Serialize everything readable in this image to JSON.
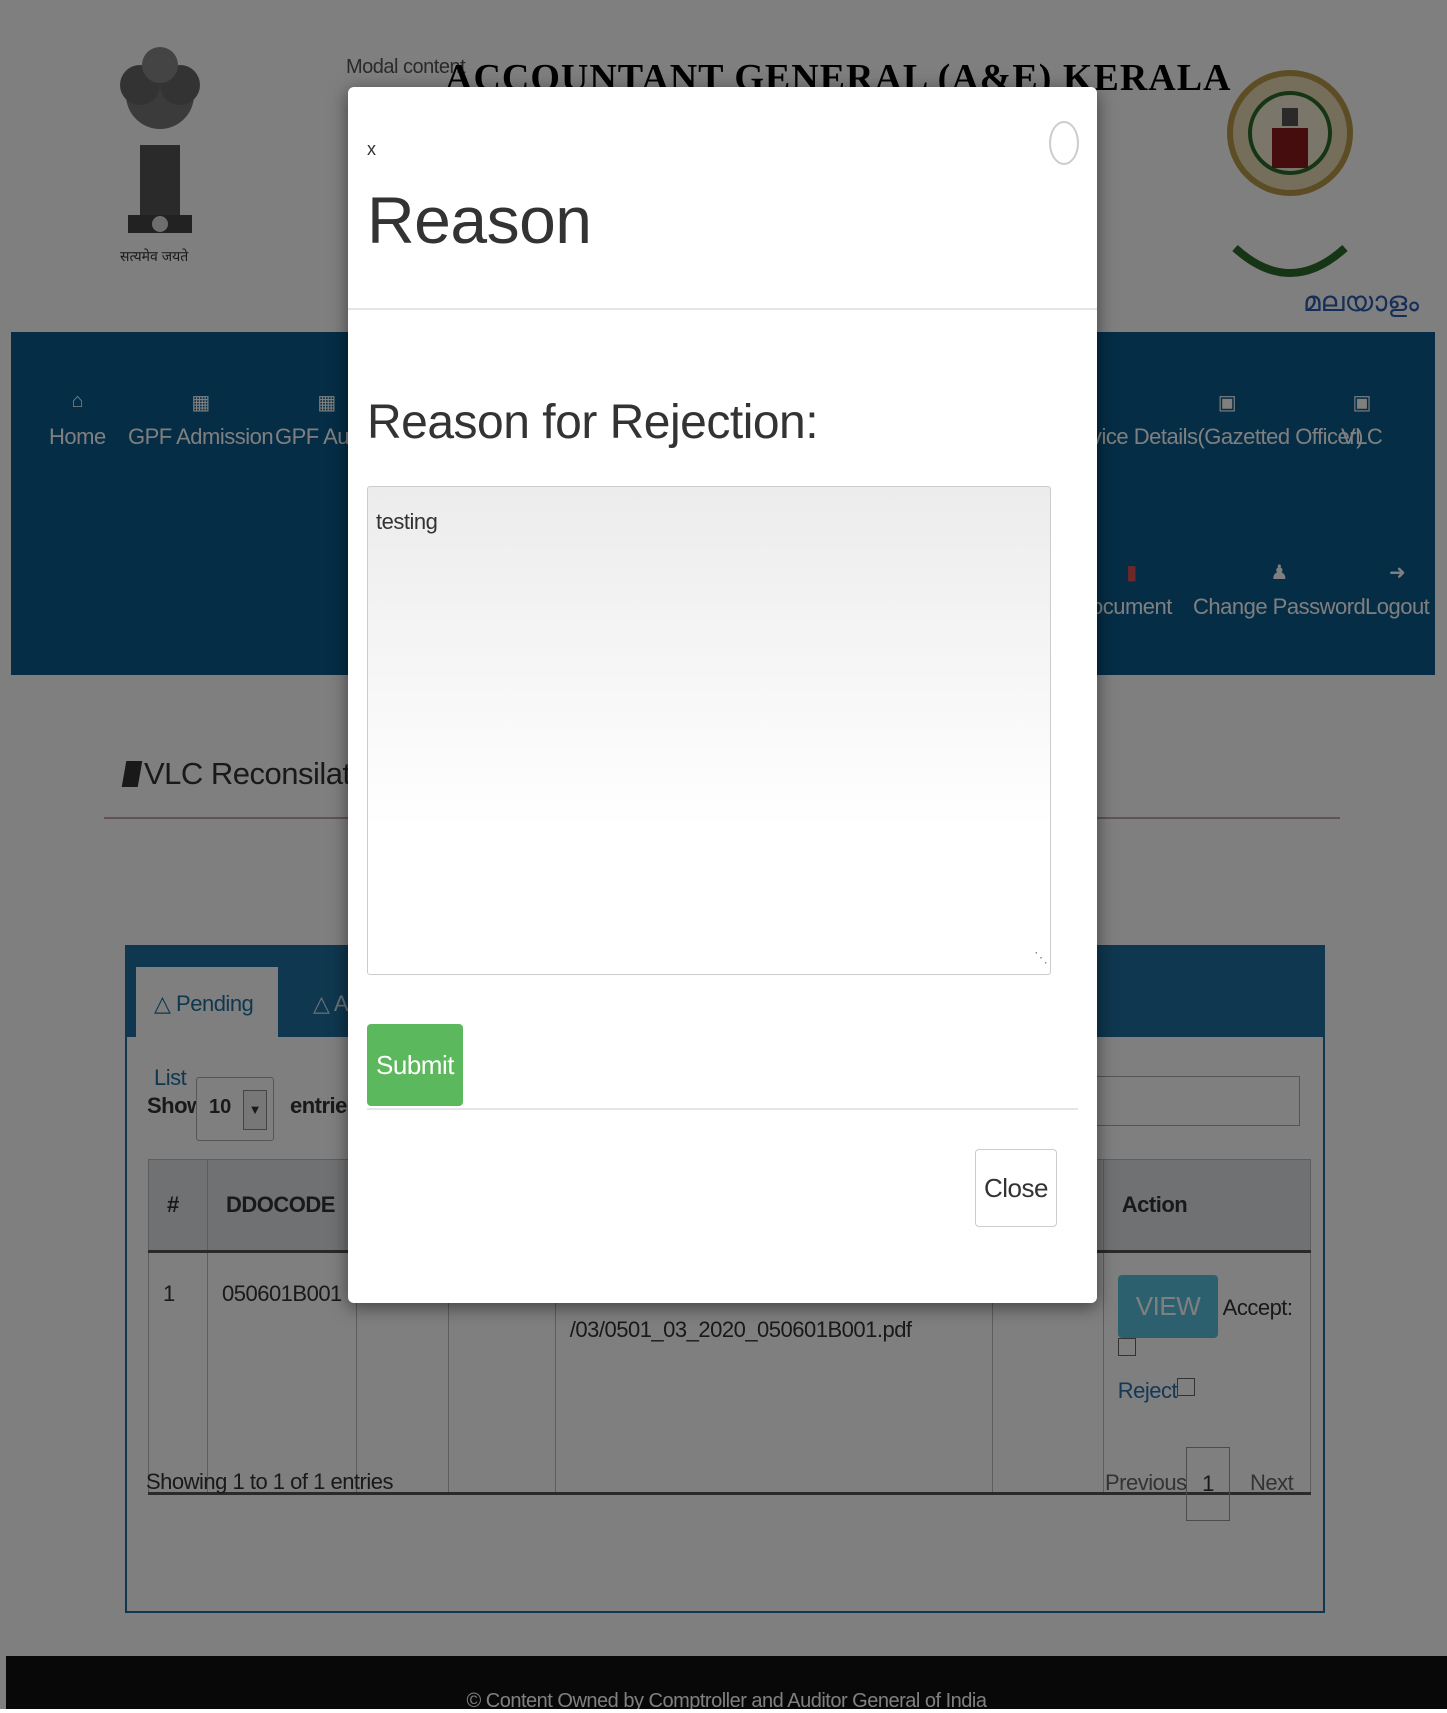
{
  "header": {
    "site_title": "ACCOUNTANT GENERAL (A&E) KERALA",
    "modal_content_label": "Modal content",
    "emblem_motto": "सत्यमेव जयते",
    "language_link": "മലയാളം"
  },
  "nav": {
    "row1": [
      {
        "label": "Home",
        "icon": "home-icon"
      },
      {
        "label": "GPF Admission",
        "icon": "grid-icon"
      },
      {
        "label": "GPF Autho",
        "icon": "grid-icon"
      },
      {
        "label": "vice Details(Gazetted Officer)",
        "icon": "square-icon"
      },
      {
        "label": "VLC",
        "icon": "square-icon"
      }
    ],
    "row2": [
      {
        "label": "ocument",
        "icon": "pdf-icon"
      },
      {
        "label": "Change Password",
        "icon": "user-icon"
      },
      {
        "label": "Logout",
        "icon": "logout-icon"
      }
    ]
  },
  "section": {
    "title": "VLC Reconsilation"
  },
  "tabs": {
    "pending": "Pending List",
    "other": "App"
  },
  "table_controls": {
    "show_label": "Show",
    "page_length": "10",
    "entries_label": "entries"
  },
  "table": {
    "headers": {
      "num": "#",
      "ddocode": "DDOCODE",
      "action": "Action"
    },
    "row": {
      "num": "1",
      "ddocode": "050601B001",
      "file_path": "/03/0501_03_2020_050601B001.pdf",
      "view_label": "VIEW",
      "accept_label": "Accept:",
      "reject_label": "Reject"
    },
    "info": "Showing 1 to 1 of 1 entries",
    "pagination": {
      "previous": "Previous",
      "page": "1",
      "next": "Next"
    }
  },
  "footer": {
    "text": "© Content Owned by Comptroller and Auditor General of India"
  },
  "modal": {
    "close_x": "x",
    "title": "Reason",
    "field_label": "Reason for Rejection:",
    "field_value": "testing",
    "submit_label": "Submit",
    "close_label": "Close"
  },
  "colors": {
    "navbar": "#0a5a8c",
    "panel": "#1f6e9f",
    "submit": "#5cb85c",
    "view_button": "#5bc0de",
    "footer": "#111111"
  }
}
